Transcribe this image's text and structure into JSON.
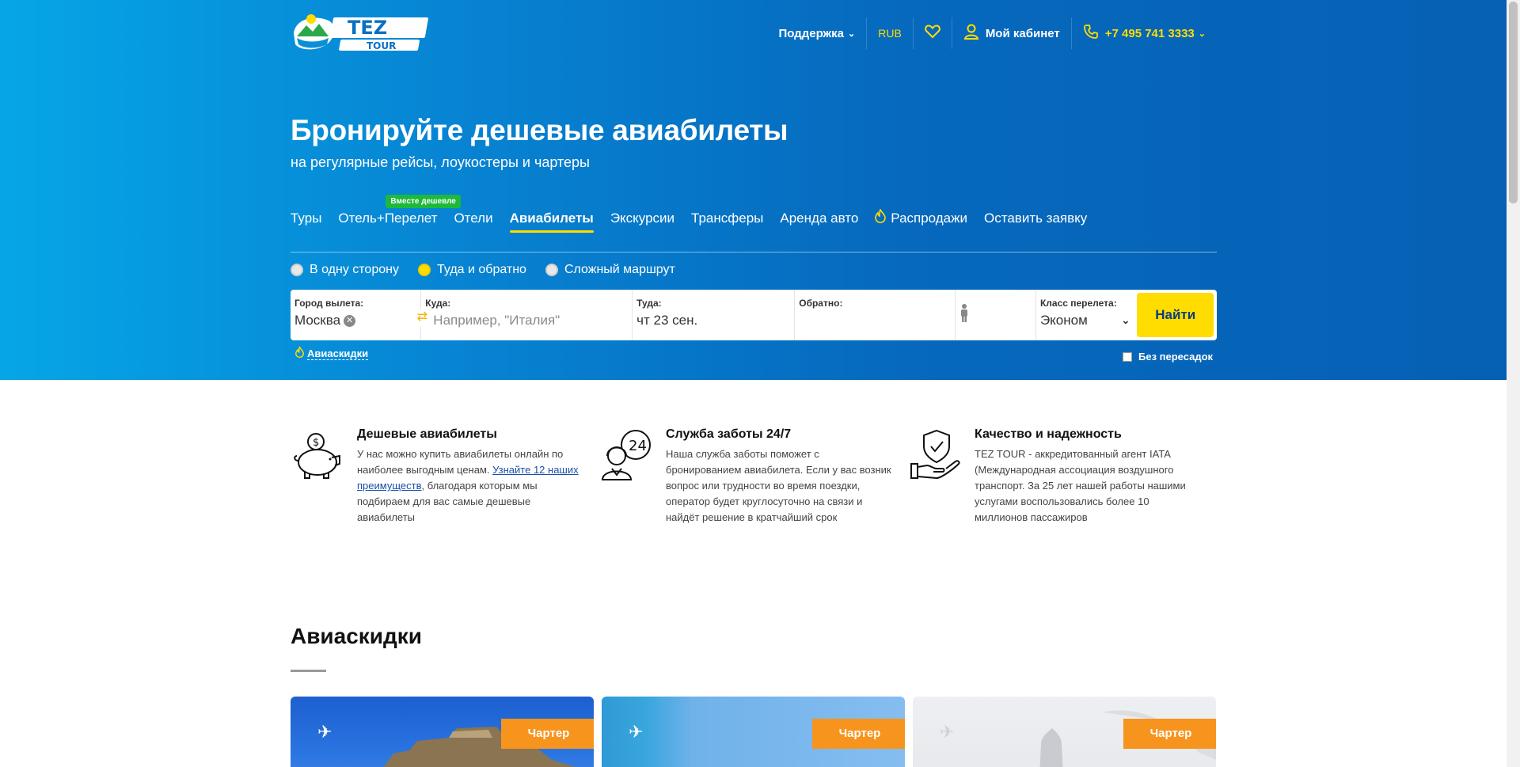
{
  "logo": {
    "top": "TEZ",
    "bottom": "TOUR"
  },
  "topnav": {
    "support": "Поддержка",
    "currency": "RUB",
    "cabinet": "Мой кабинет",
    "phone": "+7 495 741 3333"
  },
  "hero": {
    "title": "Бронируйте дешевые авиабилеты",
    "subtitle": "на регулярные рейсы, лоукостеры и чартеры"
  },
  "tabs": [
    {
      "label": "Туры"
    },
    {
      "label": "Отель+Перелет",
      "badge": "Вместе дешевле"
    },
    {
      "label": "Отели"
    },
    {
      "label": "Авиабилеты",
      "active": true
    },
    {
      "label": "Экскурсии"
    },
    {
      "label": "Трансферы"
    },
    {
      "label": "Аренда авто"
    },
    {
      "label": "Распродажи"
    },
    {
      "label": "Оставить заявку"
    }
  ],
  "trip_types": [
    {
      "label": "В одну сторону",
      "selected": false
    },
    {
      "label": "Туда и обратно",
      "selected": true
    },
    {
      "label": "Сложный маршрут",
      "selected": false
    }
  ],
  "search": {
    "from_label": "Город вылета:",
    "from_value": "Москва",
    "to_label": "Куда:",
    "to_placeholder": "Например, \"Италия\"",
    "depart_label": "Туда:",
    "depart_value": "чт 23 сен.",
    "return_label": "Обратно:",
    "class_label": "Класс перелета:",
    "class_value": "Эконом",
    "find_button": "Найти",
    "discounts_link": "Авиаскидки",
    "nonstop_label": "Без пересадок"
  },
  "features": [
    {
      "title": "Дешевые авиабилеты",
      "text_before": "У нас можно купить авиабилеты онлайн по наиболее выгодным ценам. ",
      "link": "Узнайте 12 наших преимуществ",
      "text_after": ", благодаря которым мы подбираем для вас самые дешевые авиабилеты"
    },
    {
      "title": "Служба заботы 24/7",
      "text": "Наша служба заботы поможет с бронированием авиабилета. Если у вас возник вопрос или трудности во время поездки, оператор будет круглосуточно на связи и найдёт решение в кратчайший срок"
    },
    {
      "title": "Качество и надежность",
      "text": "TEZ TOUR - аккредитованный агент IATA (Международная ассоциация воздушного транспорт. За 25 лет нашей работы нашими услугами воспользовались более 10 миллионов пассажиров"
    }
  ],
  "deals": {
    "title": "Авиаскидки",
    "cards": [
      {
        "badge": "Чартер"
      },
      {
        "badge": "Чартер"
      },
      {
        "badge": "Чартер"
      }
    ]
  },
  "colors": {
    "accent_yellow": "#ffdd00",
    "hero_blue": "#0669bd",
    "badge_orange": "#f7941d",
    "badge_green": "#1db93a"
  }
}
